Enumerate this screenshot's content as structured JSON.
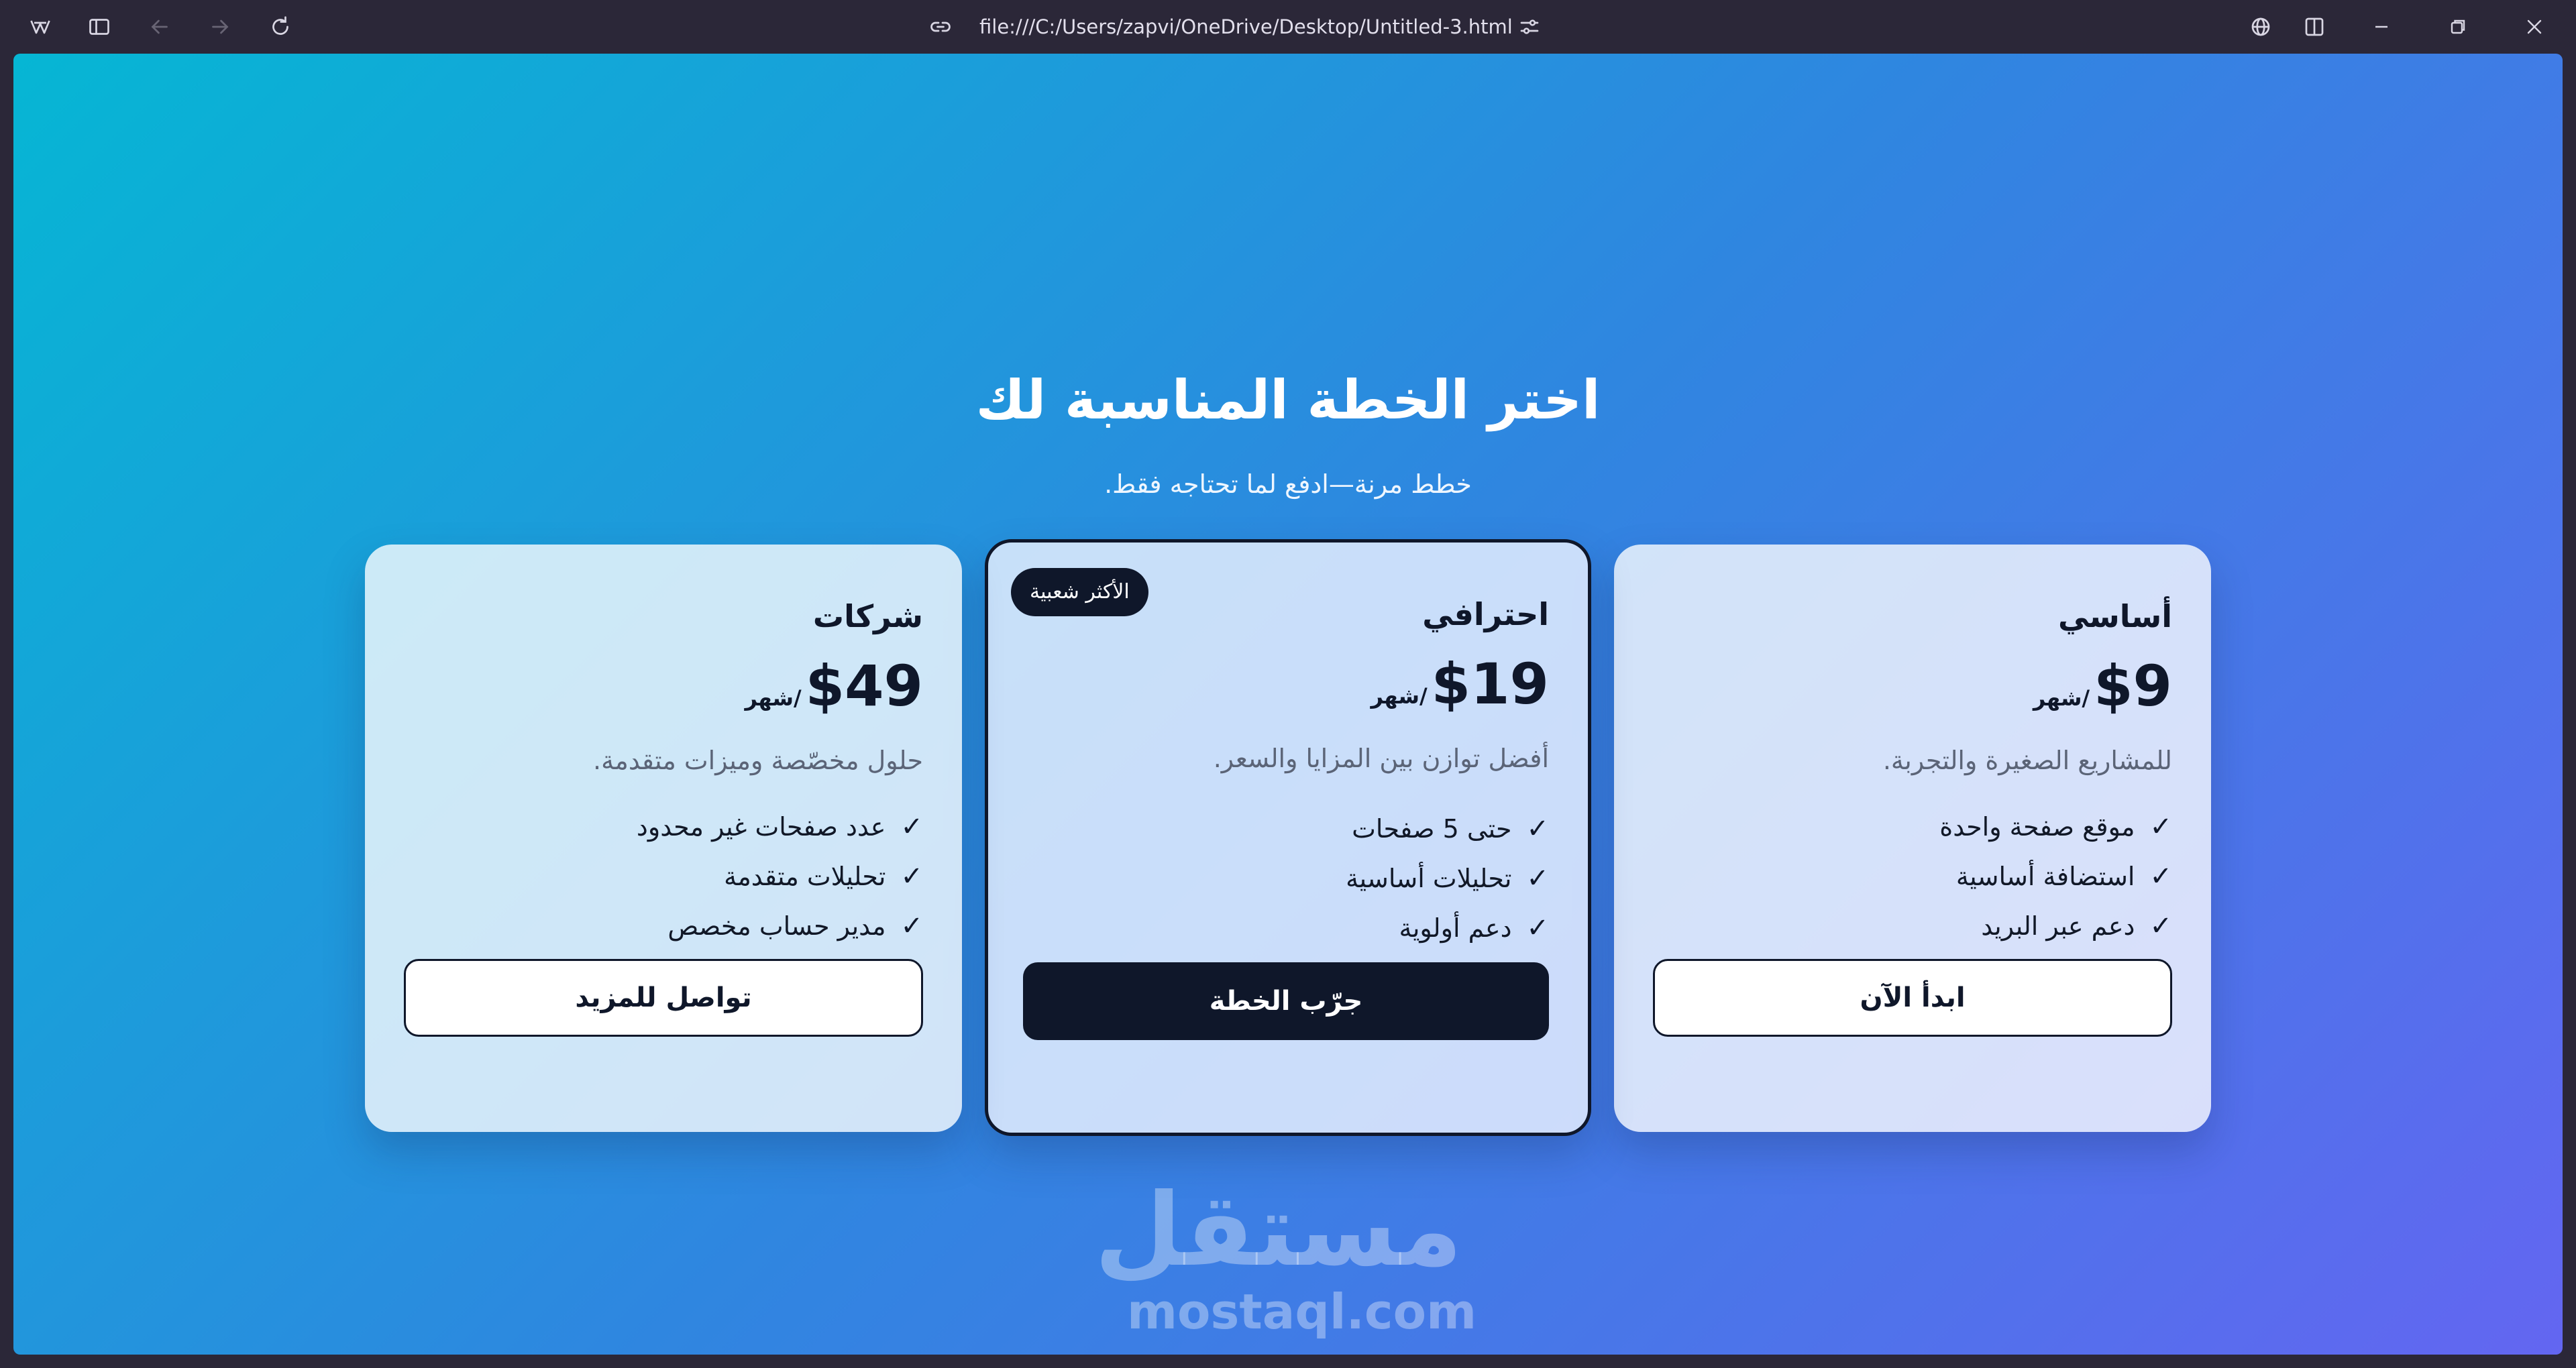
{
  "browser": {
    "url": "file:///C:/Users/zapvi/OneDrive/Desktop/Untitled-3.html"
  },
  "page": {
    "title": "اختر الخطة المناسبة لك",
    "subtitle": "خطط مرنة—ادفع لما تحتاجه فقط."
  },
  "plans": [
    {
      "name": "أساسي",
      "price": "$9",
      "period": "/شهر",
      "description": "للمشاريع الصغيرة والتجربة.",
      "features": [
        "موقع صفحة واحدة",
        "استضافة أساسية",
        "دعم عبر البريد"
      ],
      "cta": "ابدأ الآن"
    },
    {
      "name": "احترافي",
      "badge": "الأكثر شعبية",
      "price": "$19",
      "period": "/شهر",
      "description": "أفضل توازن بين المزايا والسعر.",
      "features": [
        "حتى 5 صفحات",
        "تحليلات أساسية",
        "دعم أولوية"
      ],
      "cta": "جرّب الخطة"
    },
    {
      "name": "شركات",
      "price": "$49",
      "period": "/شهر",
      "description": "حلول مخصّصة وميزات متقدمة.",
      "features": [
        "عدد صفحات غير محدود",
        "تحليلات متقدمة",
        "مدير حساب مخصص"
      ],
      "cta": "تواصل للمزيد"
    }
  ],
  "check_symbol": "✓",
  "watermark": {
    "arabic": "مستقل",
    "latin": "mostaql.com"
  },
  "colors": {
    "gradient_start": "#06b6d4",
    "gradient_end": "#6366f1",
    "dark": "#0f172a",
    "chrome": "#2b2738"
  }
}
